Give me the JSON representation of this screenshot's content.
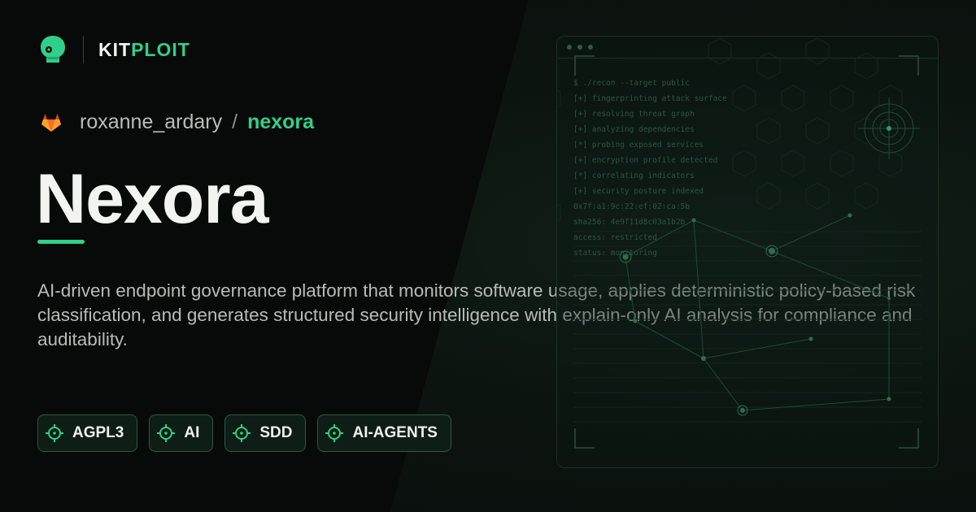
{
  "brand": {
    "kit": "KIT",
    "ploit": "PLOIT",
    "logo_icon": "kitploit-head-icon"
  },
  "repo": {
    "icon": "gitlab-fox-icon",
    "owner": "roxanne_ardary",
    "separator": "/",
    "name": "nexora"
  },
  "title": "Nexora",
  "description": "AI-driven endpoint governance platform that monitors software usage, applies deterministic policy-based risk classification, and generates structured security intelligence with explain-only AI analysis for compliance and auditability.",
  "tags": [
    {
      "label": "AGPL3",
      "icon": "crosshair-icon"
    },
    {
      "label": "AI",
      "icon": "crosshair-icon"
    },
    {
      "label": "SDD",
      "icon": "crosshair-icon"
    },
    {
      "label": "AI-AGENTS",
      "icon": "crosshair-icon"
    }
  ],
  "terminal": {
    "lines": [
      "$ ./recon --target public",
      "[+] fingerprinting attack surface",
      "[+] resolving threat graph",
      "[+] analyzing dependencies",
      "[*] probing exposed services",
      "[+] encryption profile detected",
      "[*] correlating indicators",
      "[+] security posture indexed",
      "0x7f:a1:9c:22:ef:02:ca:5b",
      "sha256: 4e9f11d8c03a1b2b",
      "access: restricted",
      "status: monitoring"
    ]
  },
  "colors": {
    "accent": "#2fd08a",
    "background": "#0b0d0c",
    "tag_border": "#2a5a43",
    "tag_background": "#0e1d16",
    "muted_text": "#b7bcb9"
  }
}
